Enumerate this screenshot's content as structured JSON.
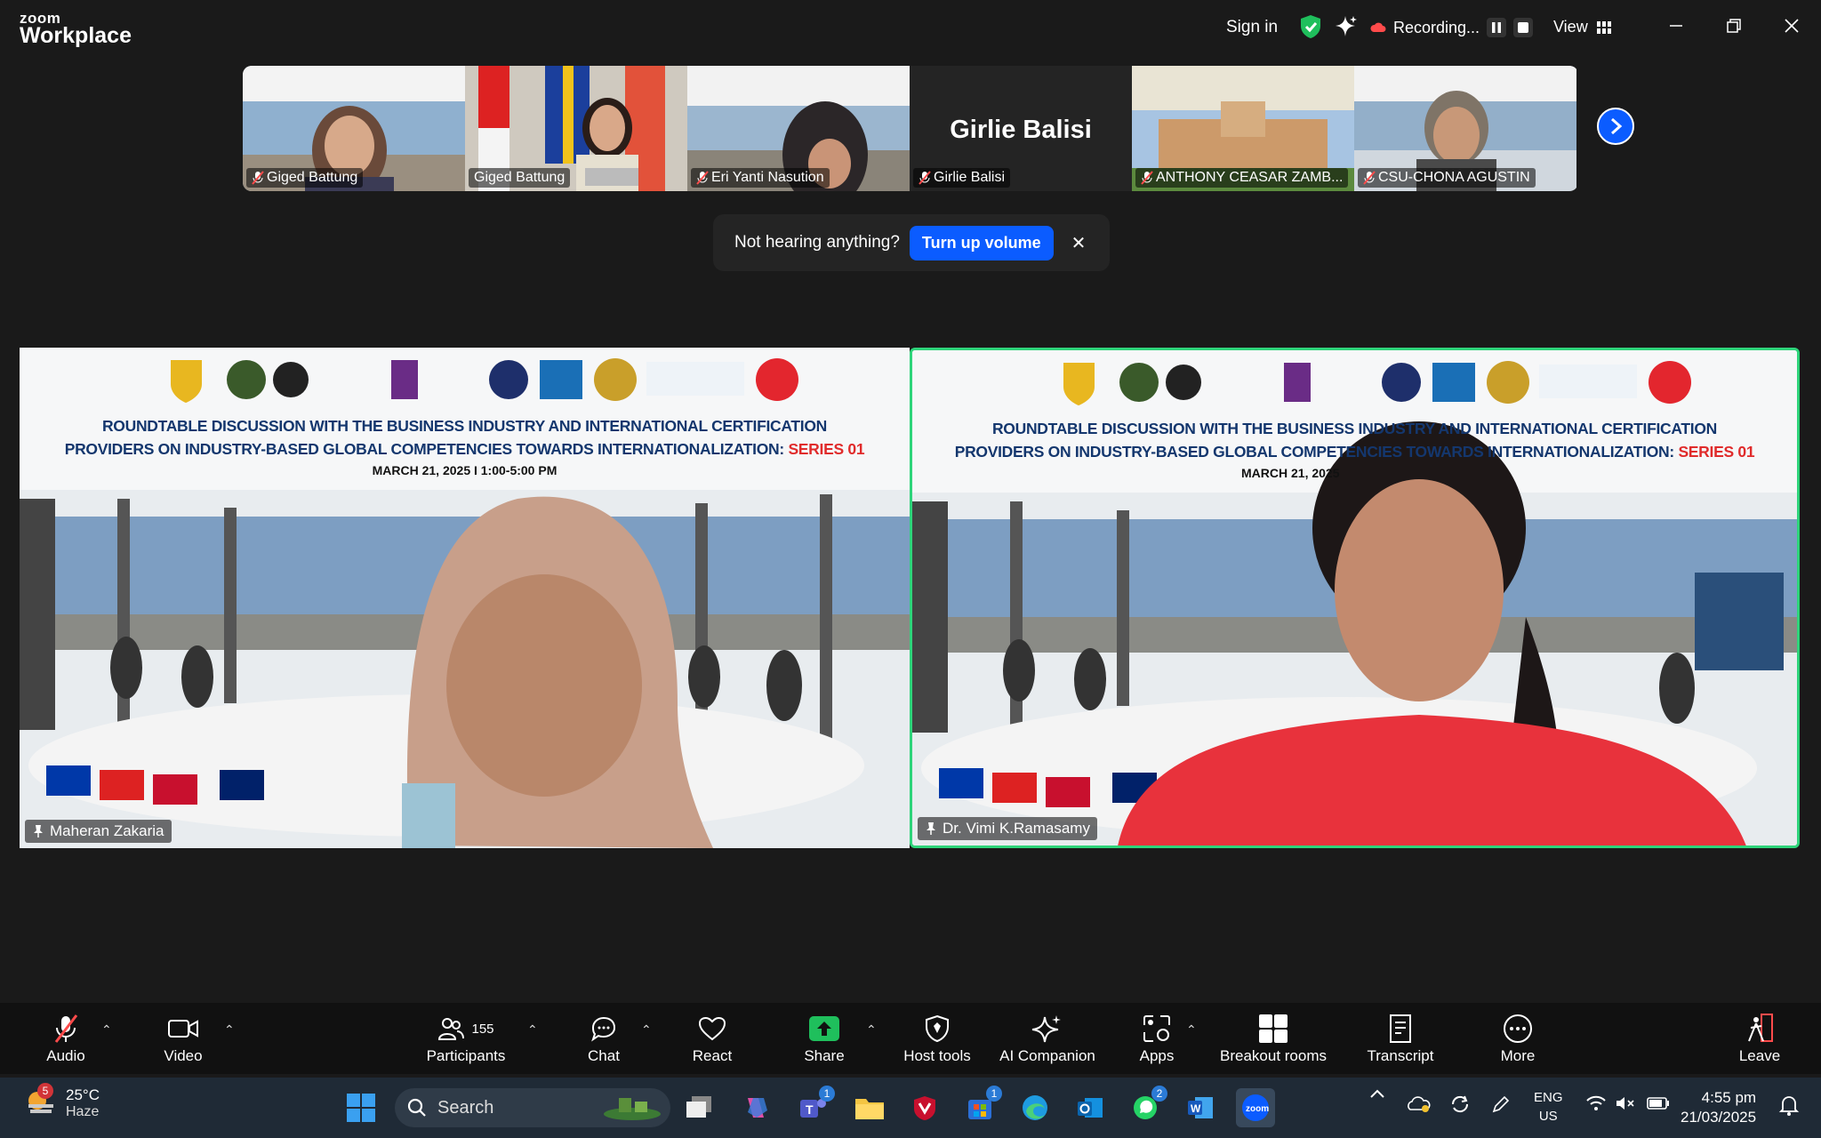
{
  "app": {
    "brand_small": "zoom",
    "brand_large": "Workplace"
  },
  "header": {
    "sign_in": "Sign in",
    "recording": "Recording...",
    "view": "View"
  },
  "strip": {
    "thumbs": [
      {
        "name": "Giged Battung",
        "muted": true
      },
      {
        "name": "Giged Battung",
        "muted": false
      },
      {
        "name": "Eri Yanti Nasution",
        "muted": true
      },
      {
        "name": "Girlie Balisi",
        "muted": true,
        "big_label": "Girlie Balisi"
      },
      {
        "name": "ANTHONY CEASAR ZAMB...",
        "muted": true
      },
      {
        "name": "CSU-CHONA AGUSTIN",
        "muted": true
      }
    ]
  },
  "toast": {
    "message": "Not hearing anything?",
    "button": "Turn up volume"
  },
  "banner": {
    "line1": "ROUNDTABLE DISCUSSION WITH THE BUSINESS INDUSTRY AND INTERNATIONAL CERTIFICATION",
    "line2": "PROVIDERS ON INDUSTRY-BASED GLOBAL COMPETENCIES TOWARDS INTERNATIONALIZATION:",
    "series": "SERIES 01",
    "date_left": "MARCH 21, 2025  I  1:00-5:00 PM",
    "date_right": "MARCH 21, 2025"
  },
  "tiles": [
    {
      "name": "Maheran Zakaria"
    },
    {
      "name": "Dr. Vimi K.Ramasamy"
    }
  ],
  "toolbar": {
    "audio": "Audio",
    "video": "Video",
    "participants": "Participants",
    "participants_count": "155",
    "chat": "Chat",
    "react": "React",
    "share": "Share",
    "host_tools": "Host tools",
    "ai_companion": "AI Companion",
    "apps": "Apps",
    "breakout": "Breakout rooms",
    "transcript": "Transcript",
    "more": "More",
    "leave": "Leave"
  },
  "taskbar": {
    "temp": "25°C",
    "condition": "Haze",
    "weather_badge": "5",
    "search": "Search",
    "teams_badge": "1",
    "store_badge": "1",
    "whatsapp_badge": "2",
    "lang1": "ENG",
    "lang2": "US",
    "time": "4:55 pm",
    "date": "21/03/2025"
  }
}
